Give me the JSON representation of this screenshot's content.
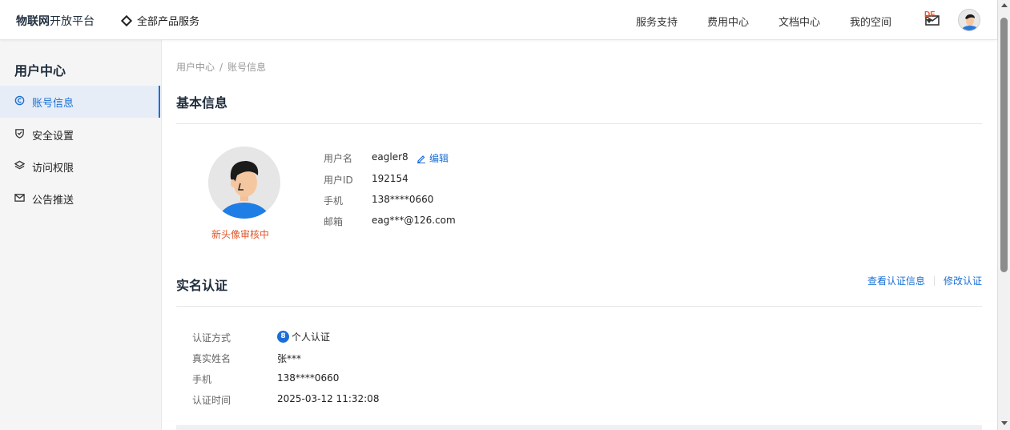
{
  "brand": {
    "bold": "物联网",
    "rest": "开放平台"
  },
  "header": {
    "all_products": "全部产品服务",
    "nav": [
      "服务支持",
      "费用中心",
      "文档中心"
    ],
    "my_space": "我的空间",
    "msg_badge": "DF"
  },
  "sidebar": {
    "title": "用户中心",
    "items": [
      {
        "label": "账号信息",
        "icon": "account-icon",
        "active": true
      },
      {
        "label": "安全设置",
        "icon": "shield-icon"
      },
      {
        "label": "访问权限",
        "icon": "layers-icon"
      },
      {
        "label": "公告推送",
        "icon": "mail-icon"
      }
    ]
  },
  "breadcrumb": {
    "parent": "用户中心",
    "sep": "/",
    "current": "账号信息"
  },
  "basic": {
    "title": "基本信息",
    "avatar_status": "新头像审核中",
    "edit": "编辑",
    "fields": [
      {
        "label": "用户名",
        "value": "eagler8"
      },
      {
        "label": "用户ID",
        "value": "192154"
      },
      {
        "label": "手机",
        "value": "138****0660"
      },
      {
        "label": "邮箱",
        "value": "eag***@126.com"
      }
    ]
  },
  "auth": {
    "title": "实名认证",
    "view": "查看认证信息",
    "modify": "修改认证",
    "fields": [
      {
        "label": "认证方式",
        "value": "个人认证"
      },
      {
        "label": "真实姓名",
        "value": "张***"
      },
      {
        "label": "手机",
        "value": "138****0660"
      },
      {
        "label": "认证时间",
        "value": "2025-03-12 11:32:08"
      }
    ]
  },
  "colors": {
    "accent": "#1a6fd6",
    "warning": "#e0572b",
    "msg": "#e0572b"
  }
}
